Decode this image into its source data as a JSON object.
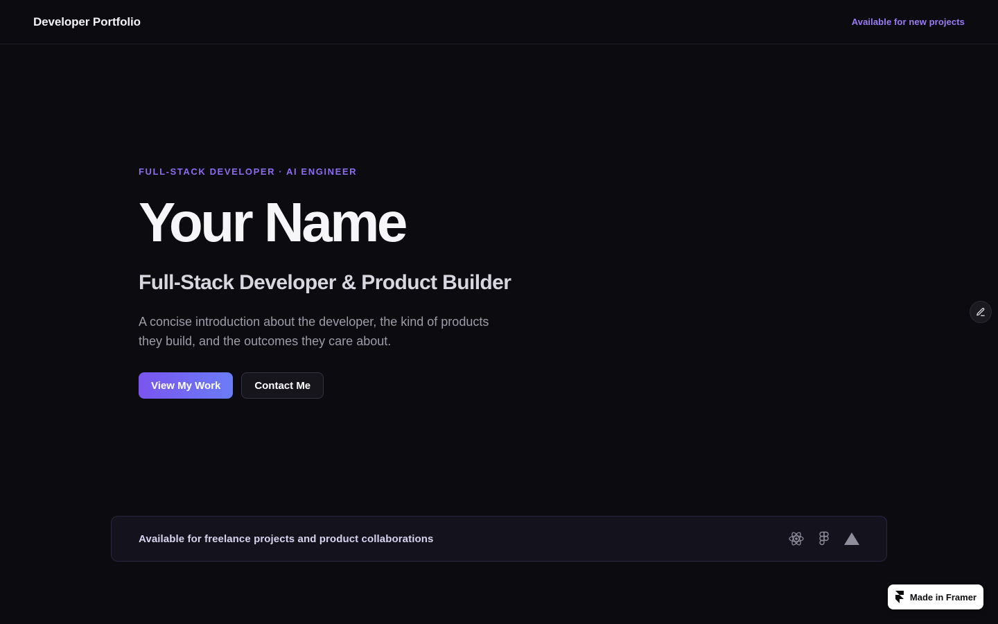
{
  "header": {
    "brand": "Developer Portfolio",
    "status": "Available for new projects"
  },
  "hero": {
    "eyebrow": "FULL-STACK DEVELOPER · AI ENGINEER",
    "name": "Your Name",
    "role": "Full-Stack Developer & Product Builder",
    "intro": "A concise introduction about the developer, the kind of products they build, and the outcomes they care about.",
    "primary_button": "View My Work",
    "secondary_button": "Contact Me"
  },
  "availability": {
    "text": "Available for freelance projects and product collaborations",
    "icons": [
      "react-icon",
      "figma-icon",
      "vercel-icon"
    ]
  },
  "edit_button": {
    "icon": "pencil-icon"
  },
  "framer_badge": {
    "label": "Made in Framer",
    "icon": "framer-icon"
  },
  "colors": {
    "background": "#0c0b10",
    "accent": "#8e6cf0",
    "primary_gradient_start": "#7a55ef",
    "primary_gradient_end": "#6a7cf6"
  }
}
